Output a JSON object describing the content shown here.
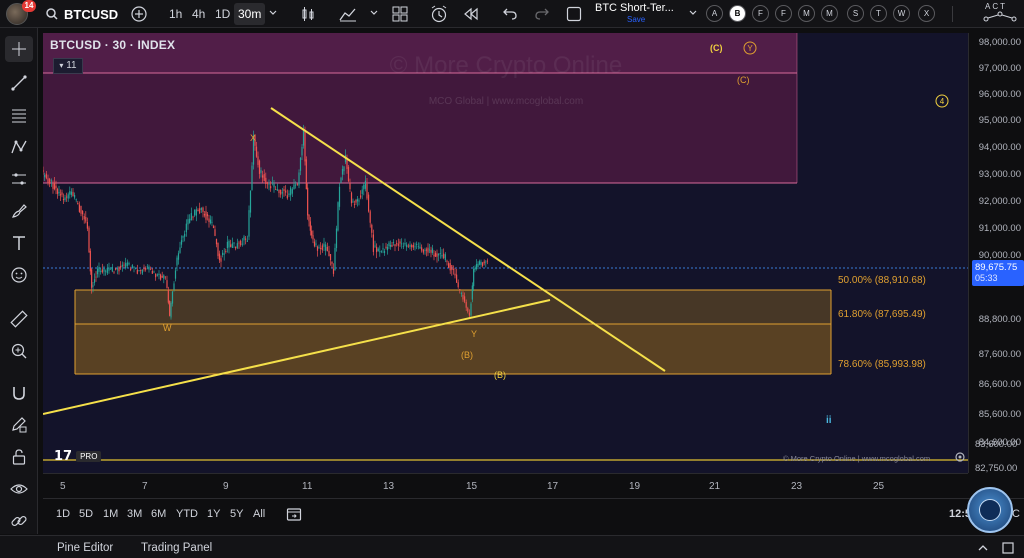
{
  "header": {
    "notification_count": "14",
    "symbol": "BTCUSD",
    "intervals": [
      "1h",
      "4h",
      "1D",
      "30m"
    ],
    "active_interval": "30m",
    "layout_name": "BTC Short-Ter...",
    "layout_save": "Save",
    "wave_buttons": [
      "A",
      "B",
      "F",
      "F",
      "M",
      "M",
      "S",
      "T",
      "W",
      "X"
    ],
    "right_text": "ACT"
  },
  "chart": {
    "title": "BTCUSD · 30 · INDEX",
    "indicator_count": "11",
    "watermark_title": "© More Crypto Online",
    "watermark_sub": "MCO Global  |  www.mcoglobal.com",
    "footer_watermark": "© More Crypto Online  |  www.mcoglobal.com",
    "price_labels": [
      "98,000.00",
      "97,000.00",
      "96,000.00",
      "95,000.00",
      "94,000.00",
      "93,000.00",
      "92,000.00",
      "91,000.00",
      "90,000.00",
      "88,800.00",
      "87,600.00",
      "86,600.00",
      "85,600.00",
      "84,600.00",
      "83,600.00",
      "82,750.00"
    ],
    "current_price": "89,675.75",
    "countdown": "05:33",
    "time_labels": [
      "5",
      "7",
      "9",
      "11",
      "13",
      "15",
      "17",
      "19",
      "21",
      "23",
      "25"
    ],
    "fib_levels": [
      {
        "label": "50.00% (88,910.68)"
      },
      {
        "label": "61.80% (87,695.49)"
      },
      {
        "label": "78.60% (85,993.98)"
      }
    ],
    "wave_labels": {
      "w": "W",
      "x": "X",
      "y": "Y",
      "b_small": "(B)",
      "b_big": "(B)",
      "c_top": "(C)",
      "y_circle": "Y",
      "c_right": "(C)",
      "four": "4",
      "ii": "ii"
    }
  },
  "range_bar": {
    "ranges": [
      "1D",
      "5D",
      "1M",
      "3M",
      "6M",
      "YTD",
      "1Y",
      "5Y",
      "All"
    ],
    "time": "12:5",
    "tz": "C"
  },
  "bottom_panel": {
    "pine_editor": "Pine Editor",
    "trading_panel": "Trading Panel"
  },
  "colors": {
    "chart_bg": "#13132a",
    "up": "#26a69a",
    "down": "#ef5350",
    "fib_line": "#e0a030",
    "trend_line": "#f5e04a",
    "resistance_zone": "#5a1f48"
  }
}
